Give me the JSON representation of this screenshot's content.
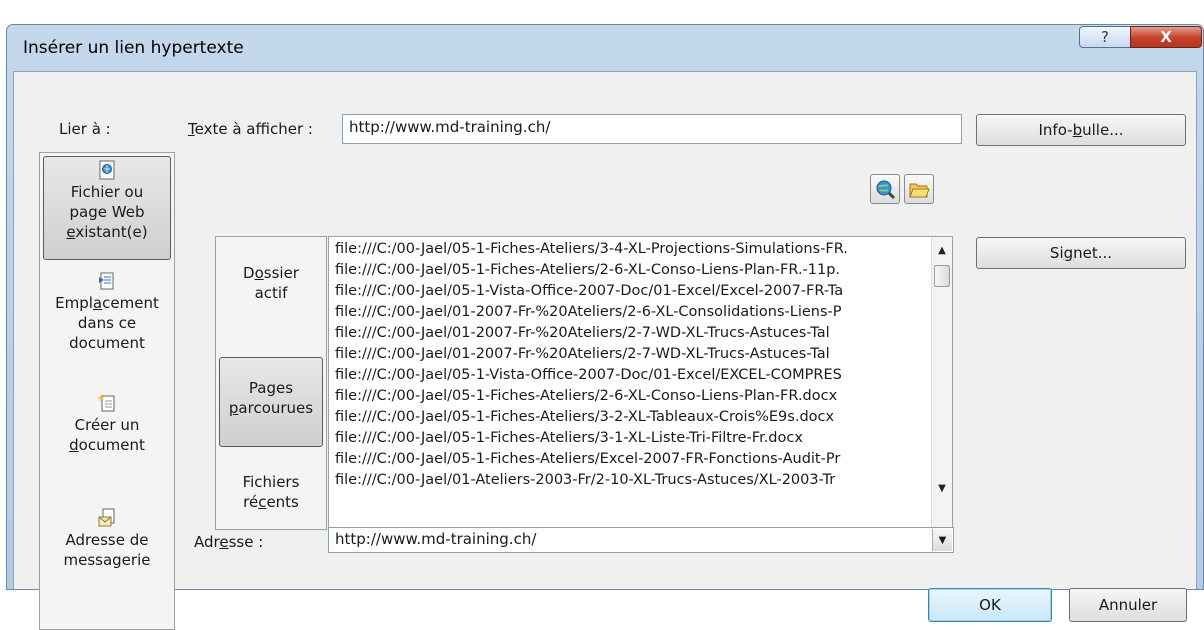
{
  "window": {
    "title": "Insérer un lien hypertexte",
    "help_label": "?",
    "close_label": "X"
  },
  "link_to": {
    "label": "Lier à :",
    "items": [
      {
        "label_lines": [
          "Fichier ou",
          "page Web",
          "existant(e)"
        ],
        "icon": "web-file-icon",
        "selected": true
      },
      {
        "label_lines": [
          "Emplacement",
          "dans ce",
          "document"
        ],
        "icon": "document-place-icon",
        "selected": false
      },
      {
        "label_lines": [
          "Créer un",
          "document"
        ],
        "icon": "new-document-icon",
        "selected": false
      },
      {
        "label_lines": [
          "Adresse de",
          "messagerie"
        ],
        "icon": "email-icon",
        "selected": false
      }
    ]
  },
  "text_to_display": {
    "label": "Texte à afficher :",
    "value": "http://www.md-training.ch/"
  },
  "buttons": {
    "tooltip": "Info-bulle...",
    "bookmark": "Signet...",
    "ok": "OK",
    "cancel": "Annuler"
  },
  "toolbar_icons": [
    "browse-web-icon",
    "browse-file-icon"
  ],
  "look_in": [
    {
      "lines": [
        "Dossier",
        "actif"
      ],
      "selected": false
    },
    {
      "lines": [
        "Pages",
        "parcourues"
      ],
      "selected": true
    },
    {
      "lines": [
        "Fichiers",
        "récents"
      ],
      "selected": false
    }
  ],
  "file_list": [
    "file:///C:/00-Jael/05-1-Fiches-Ateliers/3-4-XL-Projections-Simulations-FR.",
    "file:///C:/00-Jael/05-1-Fiches-Ateliers/2-6-XL-Conso-Liens-Plan-FR.-11p.",
    "file:///C:/00-Jael/05-1-Vista-Office-2007-Doc/01-Excel/Excel-2007-FR-Ta",
    "file:///C:/00-Jael/01-2007-Fr-%20Ateliers/2-6-XL-Consolidations-Liens-P",
    "file:///C:/00-Jael/01-2007-Fr-%20Ateliers/2-7-WD-XL-Trucs-Astuces-Tal",
    "file:///C:/00-Jael/01-2007-Fr-%20Ateliers/2-7-WD-XL-Trucs-Astuces-Tal",
    "file:///C:/00-Jael/05-1-Vista-Office-2007-Doc/01-Excel/EXCEL-COMPRES",
    "file:///C:/00-Jael/05-1-Fiches-Ateliers/2-6-XL-Conso-Liens-Plan-FR.docx",
    "file:///C:/00-Jael/05-1-Fiches-Ateliers/3-2-XL-Tableaux-Crois%E9s.docx",
    "file:///C:/00-Jael/05-1-Fiches-Ateliers/3-1-XL-Liste-Tri-Filtre-Fr.docx",
    "file:///C:/00-Jael/05-1-Fiches-Ateliers/Excel-2007-FR-Fonctions-Audit-Pr",
    "file:///C:/00-Jael/01-Ateliers-2003-Fr/2-10-XL-Trucs-Astuces/XL-2003-Tr"
  ],
  "address": {
    "label": "Adresse :",
    "value": "http://www.md-training.ch/"
  }
}
